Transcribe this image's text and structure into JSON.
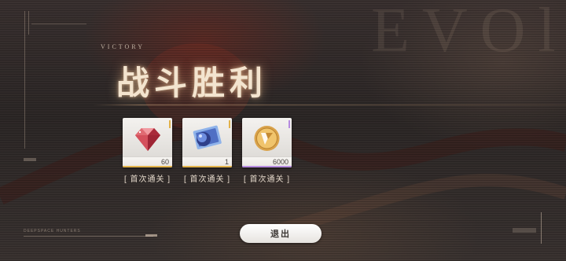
{
  "header": {
    "subtitle": "VICTORY",
    "title": "战斗胜利",
    "background_text": "EVOl"
  },
  "rewards": [
    {
      "icon": "red-diamond-icon",
      "quantity": "60",
      "label": "[ 首次通关 ]",
      "rarity_color": "#e2b24a"
    },
    {
      "icon": "blue-card-icon",
      "quantity": "1",
      "label": "[ 首次通关 ]",
      "rarity_color": "#e2b24a"
    },
    {
      "icon": "gold-coin-icon",
      "quantity": "6000",
      "label": "[ 首次通关 ]",
      "rarity_color": "#b68be0"
    }
  ],
  "footer": {
    "exit_label": "退出",
    "brand_text": "DEEPSPACE HUNTERS"
  },
  "colors": {
    "title_glow": "#f0be8c",
    "gold_rarity": "#e2b24a",
    "purple_rarity": "#b68be0"
  }
}
